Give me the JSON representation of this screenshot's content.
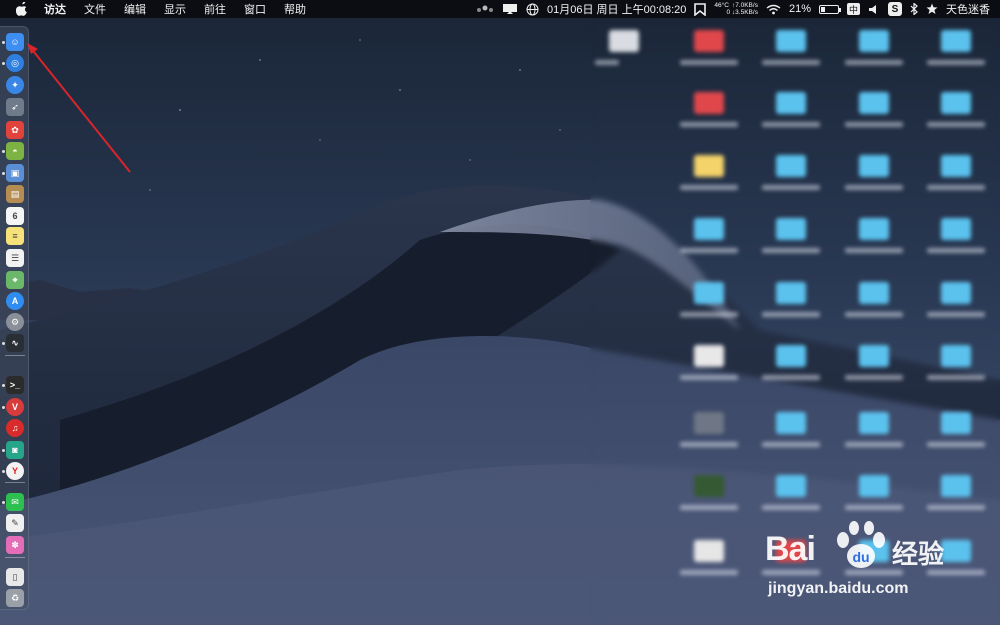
{
  "menubar": {
    "app_name": "访达",
    "items": [
      "文件",
      "编辑",
      "显示",
      "前往",
      "窗口",
      "帮助"
    ],
    "status": {
      "datetime": "01月06日 周日 上午00:08:20",
      "temp": "46°C",
      "net_up": "↑7.0KB/s",
      "net_down": "0 ↓3.5KB/s",
      "battery": "21%",
      "input_method": "中",
      "user": "天色迷香"
    }
  },
  "dock": {
    "items": [
      {
        "icon": "finder-icon",
        "color": "#3d8ef0"
      },
      {
        "icon": "safari-compass-icon",
        "color": "#2f7fe0"
      },
      {
        "icon": "safari-icon",
        "color": "#3a86e6"
      },
      {
        "icon": "launchpad-rocket-icon",
        "color": "#6f7a8a"
      },
      {
        "icon": "app-red-icon",
        "color": "#e0433c"
      },
      {
        "icon": "android-icon",
        "color": "#7cb342"
      },
      {
        "icon": "preview-icon",
        "color": "#5a8fd6"
      },
      {
        "icon": "notes-brown-icon",
        "color": "#b58c52"
      },
      {
        "icon": "calendar-icon",
        "color": "#f5f5f5"
      },
      {
        "icon": "notes-icon",
        "color": "#f7e27a"
      },
      {
        "icon": "reminders-icon",
        "color": "#f2f2f2"
      },
      {
        "icon": "maps-icon",
        "color": "#6bb86b"
      },
      {
        "icon": "app-store-icon",
        "color": "#2f8cf0"
      },
      {
        "icon": "system-preferences-icon",
        "color": "#8a8f98"
      },
      {
        "icon": "activity-monitor-icon",
        "color": "#2a2f36"
      },
      {
        "icon": "terminal-icon",
        "color": "#2b2b2b"
      },
      {
        "icon": "vivaldi-icon",
        "color": "#d83b3b"
      },
      {
        "icon": "netease-music-icon",
        "color": "#d92b2b"
      },
      {
        "icon": "app-teal-icon",
        "color": "#27a58b"
      },
      {
        "icon": "yandex-browser-icon",
        "color": "#f2f2f2"
      },
      {
        "icon": "wechat-icon",
        "color": "#2dbf4f"
      },
      {
        "icon": "textedit-icon",
        "color": "#f0f0f0"
      },
      {
        "icon": "photos-icon",
        "color": "#e46db8"
      },
      {
        "icon": "document-icon",
        "color": "#e8e8e8"
      },
      {
        "icon": "trash-icon",
        "color": "#9aa0a8"
      }
    ]
  },
  "watermark": {
    "brand": "Bai",
    "brand_suffix": "经验",
    "url": "jingyan.baidu.com"
  }
}
